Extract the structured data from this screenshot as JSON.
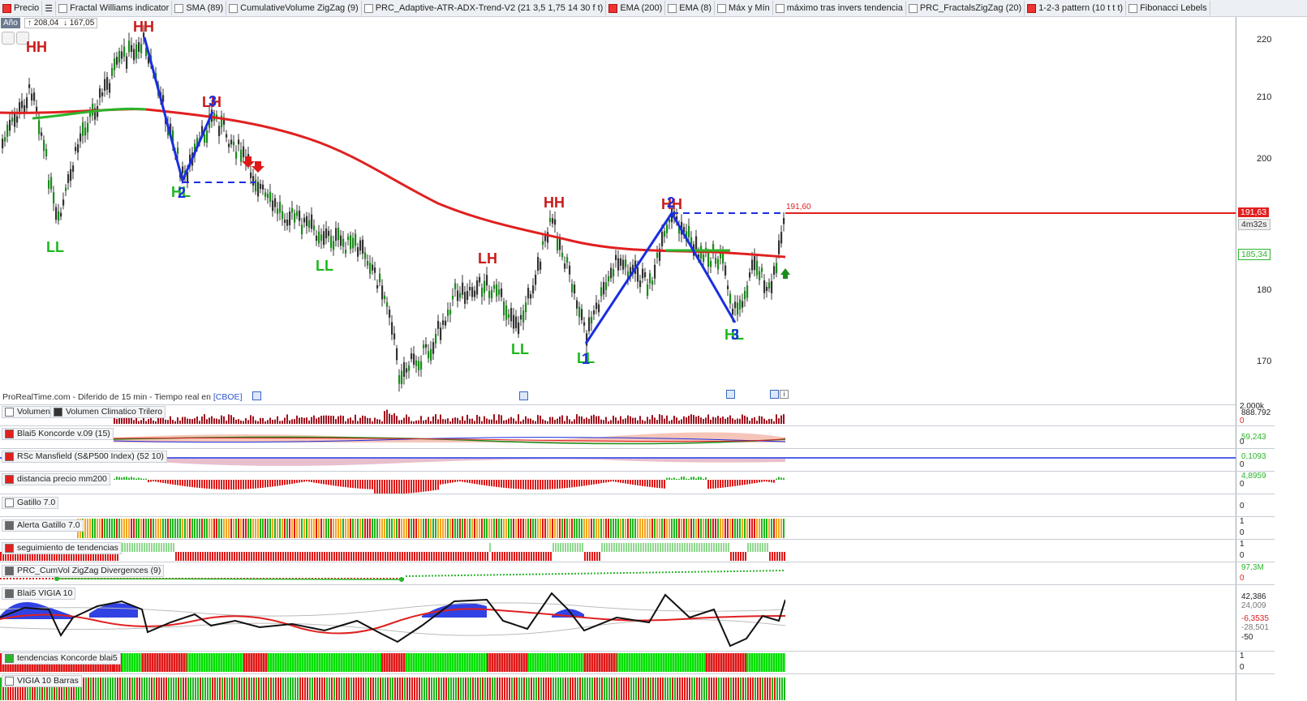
{
  "toolbar": {
    "items": [
      "Precio",
      "Fractal Williams indicator",
      "SMA (89)",
      "CumulativeVolume ZigZag (9)",
      "PRC_Adaptive-ATR-ADX-Trend-V2 (21 3,5 1,75 14 30 f t)",
      "EMA (200)",
      "EMA (8)",
      "Máx y Mín",
      "máximo tras invers  tendencia",
      "PRC_FractalsZigZag (20)",
      "1-2-3 pattern (10 t t t)",
      "Fibonacci Lebels"
    ]
  },
  "period": "Año",
  "hilo": {
    "high": "208,04",
    "low": "167,05"
  },
  "footer_source": "ProRealTime.com - Diferido de 15 min - Tiempo real en",
  "footer_exchange": "[CBOE]",
  "price_axis": {
    "ticks": [
      "220",
      "210",
      "200",
      "180",
      "170"
    ],
    "current_price": "191,63",
    "countdown": "4m32s",
    "ema_value": "185,34",
    "level_label": "191,60"
  },
  "swing_labels": {
    "hh1": "HH",
    "hh2": "HH",
    "ll1": "LL",
    "lh1": "LH",
    "h2": "HL",
    "n2a": "2",
    "ll2": "LL",
    "ll3": "LL",
    "lh2": "LH",
    "hh3": "HH",
    "l1": "LL",
    "n1": "1",
    "h2b": "HH",
    "n2b": "2",
    "h3": "HL",
    "n3": "3",
    "lh3": "LH",
    "n3a": "3"
  },
  "panes": {
    "volume": {
      "label1": "Volumen",
      "label2": "Volumen Climatico Trilero",
      "axis_top": "2.000k",
      "axis_val": "888.792",
      "axis_zero": "0"
    },
    "koncorde": {
      "label": "Blai5 Koncorde v.09 (15)",
      "axis_val": "59,243",
      "axis_zero": "0"
    },
    "mansfield": {
      "label": "RSc Mansfield (S&P500 Index) (52 10)",
      "axis_val": "0,1093",
      "axis_zero": "0"
    },
    "distancia": {
      "label": "distancia precio mm200",
      "axis_val": "4,8959",
      "axis_zero": "0"
    },
    "gatillo": {
      "label": "Gatillo 7.0",
      "axis_val": "0"
    },
    "alerta": {
      "label": "Alerta Gatillo 7.0",
      "axis_top": "1",
      "axis_zero": "0"
    },
    "seguimiento": {
      "label": "seguimiento de tendencias",
      "axis_top": "1",
      "axis_zero": "0"
    },
    "cumvol": {
      "label": "PRC_CumVol ZigZag Divergences (9)",
      "axis_val": "97,3M",
      "axis_zero": "0"
    },
    "vigia": {
      "label": "Blai5 VIGIA 10",
      "axis_vals": [
        "42,386",
        "24,009",
        "-6,3535",
        "-28,501",
        "-50"
      ]
    },
    "tendencias": {
      "label": "tendencias Koncorde blai5",
      "axis_top": "1",
      "axis_zero": "0"
    },
    "vigia_barras": {
      "label": "VIGIA 10 Barras"
    }
  },
  "colors": {
    "ema200": "#e02020",
    "pattern": "#1a2ee0",
    "bull": "#1cb81c",
    "bear": "#e01818",
    "orange": "#f5a623"
  }
}
